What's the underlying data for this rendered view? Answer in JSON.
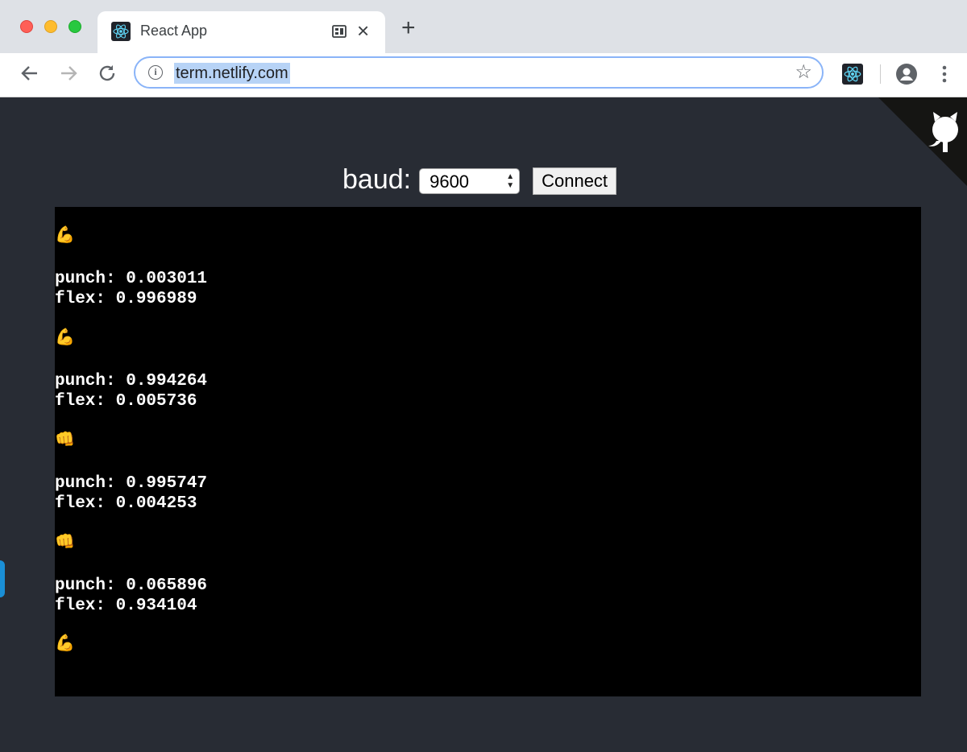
{
  "browser": {
    "tab_title": "React App",
    "close_glyph": "×",
    "new_tab_glyph": "+",
    "url": "term.netlify.com",
    "info_glyph": "i",
    "star_glyph": "☆"
  },
  "page": {
    "baud_label": "baud:",
    "baud_value": "9600",
    "connect_label": "Connect"
  },
  "terminal": {
    "entries": [
      {
        "emoji": "💪",
        "lines": [
          "punch: 0.003011",
          "flex: 0.996989"
        ]
      },
      {
        "emoji": "💪",
        "lines": [
          "punch: 0.994264",
          "flex: 0.005736"
        ]
      },
      {
        "emoji": "👊",
        "lines": [
          "punch: 0.995747",
          "flex: 0.004253"
        ]
      },
      {
        "emoji": "👊",
        "lines": [
          "punch: 0.065896",
          "flex: 0.934104"
        ]
      },
      {
        "emoji": "💪",
        "lines": []
      }
    ]
  },
  "colors": {
    "page_bg": "#282c34",
    "terminal_bg": "#000000",
    "terminal_text": "#ffffff",
    "react_cyan": "#61dafb"
  },
  "icons": [
    "react-icon",
    "back-arrow-icon",
    "forward-arrow-icon",
    "reload-icon",
    "info-icon",
    "star-icon",
    "profile-icon",
    "kebab-menu-icon",
    "github-octocat-icon",
    "flexed-biceps-icon",
    "oncoming-fist-icon"
  ]
}
